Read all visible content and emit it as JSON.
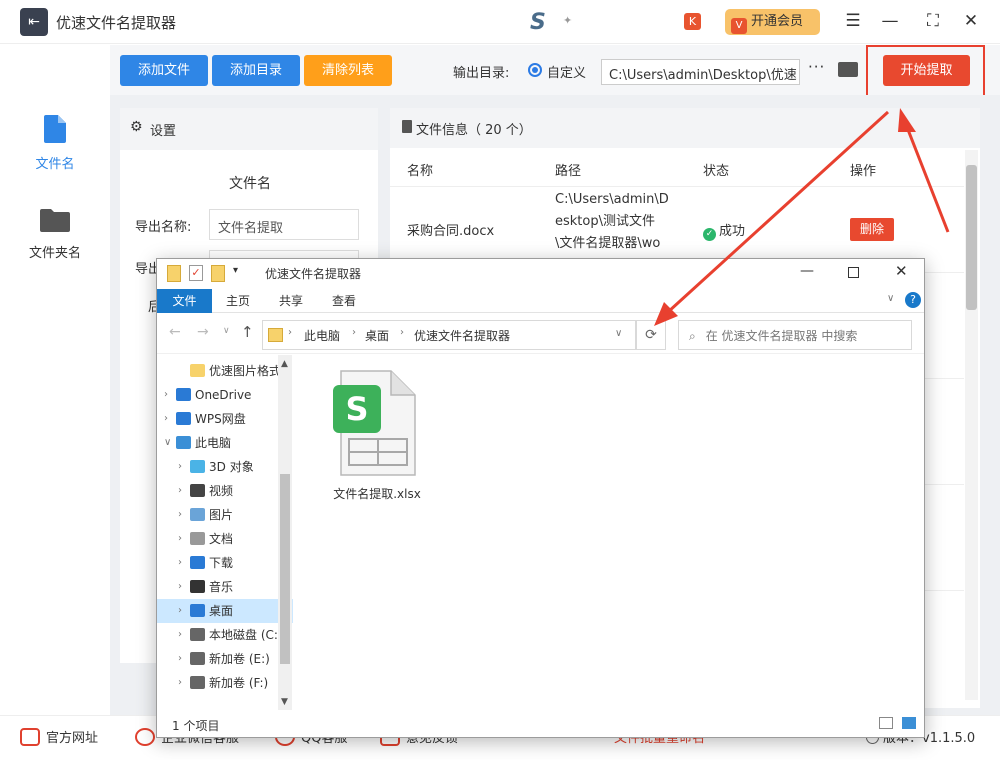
{
  "app": {
    "title": "优速文件名提取器",
    "vip_label": "开通会员",
    "start_label": "开始提取"
  },
  "colors": {
    "primary_blue": "#2f86e6",
    "orange": "#ff9f1a",
    "red": "#e8492f",
    "vip_gold": "#f8c269",
    "success_green": "#2bb66b"
  },
  "nav": {
    "items": [
      {
        "label": "文件名",
        "icon": "file-icon",
        "active": true
      },
      {
        "label": "文件夹名",
        "icon": "folder-icon",
        "active": false
      }
    ]
  },
  "toolbar": {
    "add_file": "添加文件",
    "add_dir": "添加目录",
    "clear_list": "清除列表",
    "output_label": "输出目录:",
    "radio_label": "自定义",
    "path": "C:\\Users\\admin\\Desktop\\优速",
    "more": "···"
  },
  "settings": {
    "header": "设置",
    "section": "文件名",
    "export_name_label": "导出名称:",
    "export_name_value": "文件名提取",
    "row2_label": "导出",
    "row3_label": "后"
  },
  "fileinfo": {
    "header": "文件信息（ 20 个）",
    "columns": [
      "名称",
      "路径",
      "状态",
      "操作"
    ],
    "rows": [
      {
        "name": "采购合同.docx",
        "path_lines": [
          "C:\\Users\\admin\\D",
          "esktop\\测试文件",
          "\\文件名提取器\\wo"
        ],
        "status": "成功",
        "action": "删除"
      }
    ]
  },
  "bottom": {
    "items": [
      "官方网址",
      "企业微信客服",
      "QQ客服",
      "意见反馈"
    ],
    "center": "文件批量重命名",
    "version_label": "版本：",
    "version": "v1.1.5.0"
  },
  "explorer": {
    "title": "优速文件名提取器",
    "tabs": [
      "文件",
      "主页",
      "共享",
      "查看"
    ],
    "breadcrumb": [
      "此电脑",
      "桌面",
      "优速文件名提取器"
    ],
    "search_placeholder": "在 优速文件名提取器 中搜索",
    "tree": [
      {
        "label": "优速图片格式",
        "icon": "folder-icon"
      },
      {
        "label": "OneDrive",
        "icon": "cloud-icon"
      },
      {
        "label": "WPS网盘",
        "icon": "cloud-icon"
      },
      {
        "label": "此电脑",
        "icon": "computer-icon"
      },
      {
        "label": "3D 对象",
        "icon": "cube-icon"
      },
      {
        "label": "视频",
        "icon": "video-icon"
      },
      {
        "label": "图片",
        "icon": "picture-icon"
      },
      {
        "label": "文档",
        "icon": "document-icon"
      },
      {
        "label": "下载",
        "icon": "download-icon"
      },
      {
        "label": "音乐",
        "icon": "music-icon"
      },
      {
        "label": "桌面",
        "icon": "desktop-icon"
      },
      {
        "label": "本地磁盘 (C:",
        "icon": "drive-icon"
      },
      {
        "label": "新加卷 (E:)",
        "icon": "drive-icon"
      },
      {
        "label": "新加卷 (F:)",
        "icon": "drive-icon"
      }
    ],
    "file": {
      "name": "文件名提取.xlsx",
      "icon": "spreadsheet-icon",
      "badge": "S"
    },
    "status": "1 个项目"
  }
}
